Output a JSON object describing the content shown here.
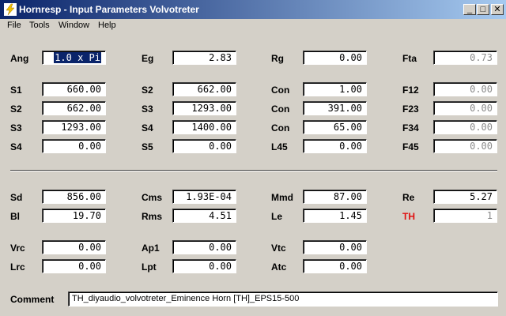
{
  "window": {
    "title": "Hornresp - Input Parameters   Volvotreter",
    "minimize": "_",
    "maximize": "□",
    "close": "✕"
  },
  "menu": [
    "File",
    "Tools",
    "Window",
    "Help"
  ],
  "labels": {
    "ang": "Ang",
    "eg": "Eg",
    "rg": "Rg",
    "fta": "Fta",
    "s1": "S1",
    "s2a": "S2",
    "con1": "Con",
    "f12": "F12",
    "s2b": "S2",
    "s3a": "S3",
    "con2": "Con",
    "f23": "F23",
    "s3b": "S3",
    "s4a": "S4",
    "con3": "Con",
    "f34": "F34",
    "s4b": "S4",
    "s5": "S5",
    "l45": "L45",
    "f45": "F45",
    "sd": "Sd",
    "cms": "Cms",
    "mmd": "Mmd",
    "re": "Re",
    "bl": "Bl",
    "rms": "Rms",
    "le": "Le",
    "th": "TH",
    "vrc": "Vrc",
    "ap1": "Ap1",
    "vtc": "Vtc",
    "lrc": "Lrc",
    "lpt": "Lpt",
    "atc": "Atc",
    "comment": "Comment"
  },
  "values": {
    "ang": "1.0 x Pi",
    "eg": "2.83",
    "rg": "0.00",
    "fta": "0.73",
    "s1": "660.00",
    "s2a": "662.00",
    "con1": "1.00",
    "f12": "0.00",
    "s2b": "662.00",
    "s3a": "1293.00",
    "con2": "391.00",
    "f23": "0.00",
    "s3b": "1293.00",
    "s4a": "1400.00",
    "con3": "65.00",
    "f34": "0.00",
    "s4b": "0.00",
    "s5": "0.00",
    "l45": "0.00",
    "f45": "0.00",
    "sd": "856.00",
    "cms": "1.93E-04",
    "mmd": "87.00",
    "re": "5.27",
    "bl": "19.70",
    "rms": "4.51",
    "le": "1.45",
    "th": "1",
    "vrc": "0.00",
    "ap1": "0.00",
    "vtc": "0.00",
    "lrc": "0.00",
    "lpt": "0.00",
    "atc": "0.00",
    "comment": "TH_diyaudio_volvotreter_Eminence Horn [TH]_EPS15-500"
  },
  "colors": {
    "titlebar_start": "#0a246a",
    "titlebar_end": "#a6caf0",
    "th_label": "#e01010",
    "disabled_text": "#8c8c8c"
  }
}
